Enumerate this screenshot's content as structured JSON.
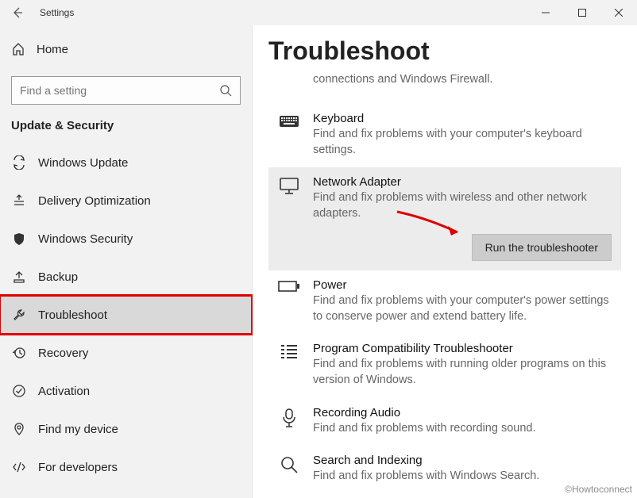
{
  "window": {
    "title": "Settings"
  },
  "sidebar": {
    "home": "Home",
    "search_placeholder": "Find a setting",
    "section": "Update & Security",
    "items": [
      {
        "label": "Windows Update"
      },
      {
        "label": "Delivery Optimization"
      },
      {
        "label": "Windows Security"
      },
      {
        "label": "Backup"
      },
      {
        "label": "Troubleshoot"
      },
      {
        "label": "Recovery"
      },
      {
        "label": "Activation"
      },
      {
        "label": "Find my device"
      },
      {
        "label": "For developers"
      }
    ]
  },
  "main": {
    "heading": "Troubleshoot",
    "partial_desc": "connections and Windows Firewall.",
    "items": [
      {
        "title": "Keyboard",
        "desc": "Find and fix problems with your computer's keyboard settings."
      },
      {
        "title": "Network Adapter",
        "desc": "Find and fix problems with wireless and other network adapters.",
        "button": "Run the troubleshooter"
      },
      {
        "title": "Power",
        "desc": "Find and fix problems with your computer's power settings to conserve power and extend battery life."
      },
      {
        "title": "Program Compatibility Troubleshooter",
        "desc": "Find and fix problems with running older programs on this version of Windows."
      },
      {
        "title": "Recording Audio",
        "desc": "Find and fix problems with recording sound."
      },
      {
        "title": "Search and Indexing",
        "desc": "Find and fix problems with Windows Search."
      }
    ]
  },
  "watermark": "©Howtoconnect"
}
